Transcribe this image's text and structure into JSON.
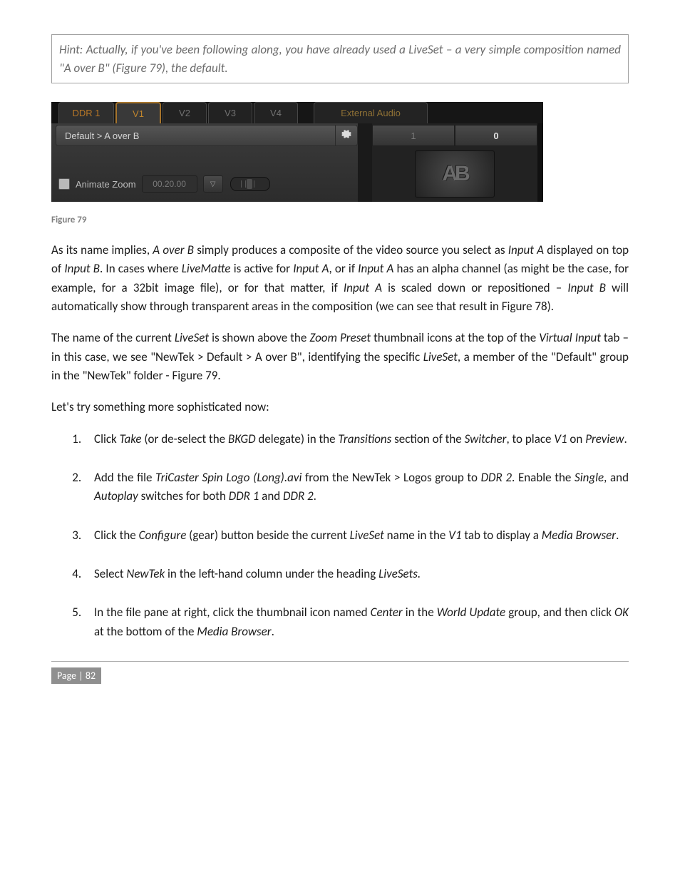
{
  "hint": "Hint: Actually, if you've been following along, you have already used a LiveSet – a very simple composition named \"A over B\" (Figure 79), the default.",
  "screenshot": {
    "tabs": {
      "ddr1": "DDR 1",
      "v1": "V1",
      "v2": "V2",
      "v3": "V3",
      "v4": "V4",
      "audio": "External Audio"
    },
    "liveset_path": "Default > A over B",
    "animate_label": "Animate Zoom",
    "time_value": "00.20.00",
    "preset_left": "1",
    "preset_right": "0",
    "thumb_text": "AB"
  },
  "figure_caption": "Figure 79",
  "para1_parts": {
    "t1": "As its name implies, ",
    "i1": "A over B",
    "t2": " simply produces a composite of the video source you select as ",
    "i2": "Input A",
    "t3": " displayed on top of ",
    "i3": "Input B",
    "t4": ".  In cases where ",
    "i4": "LiveMatte",
    "t5": " is active for ",
    "i5": "Input A",
    "t6": ", or if ",
    "i6": "Input A",
    "t7": " has an alpha channel (as might be the case, for example, for a 32bit image file), or for that matter, if ",
    "i7": "Input A",
    "t8": " is scaled down or repositioned – ",
    "i8": "Input B",
    "t9": " will automatically show through transparent areas in the composition (we can see that result in Figure 78)."
  },
  "para2_parts": {
    "t1": "The name of the current ",
    "i1": "LiveSet",
    "t2": " is shown above the ",
    "i2": "Zoom Preset",
    "t3": " thumbnail icons at the top of the ",
    "i3": "Virtual Input",
    "t4": " tab – in this case, we see \"NewTek > Default > A over B\", identifying the specific ",
    "i4": "LiveSet",
    "t5": ", a member of the \"Default\" group in the \"NewTek\" folder - Figure 79."
  },
  "para3": "Let's try something more sophisticated now:",
  "steps": {
    "s1": {
      "t1": "Click ",
      "i1": "Take",
      "t2": " (or de-select the ",
      "i2": "BKGD",
      "t3": " delegate) in the ",
      "i3": "Transitions",
      "t4": " section of the ",
      "i4": "Switcher",
      "t5": ", to place ",
      "i5": "V1",
      "t6": " on ",
      "i6": "Preview",
      "t7": "."
    },
    "s2": {
      "t1": "Add the file ",
      "i1": "TriCaster Spin Logo (Long).avi",
      "t2": " from the NewTek > Logos group to ",
      "i2": "DDR 2",
      "t3": ". Enable the ",
      "i3": "Single",
      "t4": ", and ",
      "i4": "Autoplay",
      "t5": " switches for both ",
      "i5": "DDR 1",
      "t6": " and ",
      "i6": "DDR 2",
      "t7": "."
    },
    "s3": {
      "t1": "Click the ",
      "i1": "Configure",
      "t2": " (gear) button beside the current ",
      "i2": "LiveSet",
      "t3": " name in the ",
      "i3": "V1",
      "t4": " tab to display a ",
      "i4": "Media Browser",
      "t5": "."
    },
    "s4": {
      "t1": "Select ",
      "i1": "NewTek",
      "t2": " in the left-hand column under the heading ",
      "i2": "LiveSets."
    },
    "s5": {
      "t1": "In the file pane at right, click the thumbnail icon named ",
      "i1": "Center",
      "t2": " in the ",
      "i2": "World Update",
      "t3": " group, and then click ",
      "i3": "OK",
      "t4": " at the bottom of the ",
      "i4": "Media Browser",
      "t5": "."
    }
  },
  "page_label": "Page | 82"
}
